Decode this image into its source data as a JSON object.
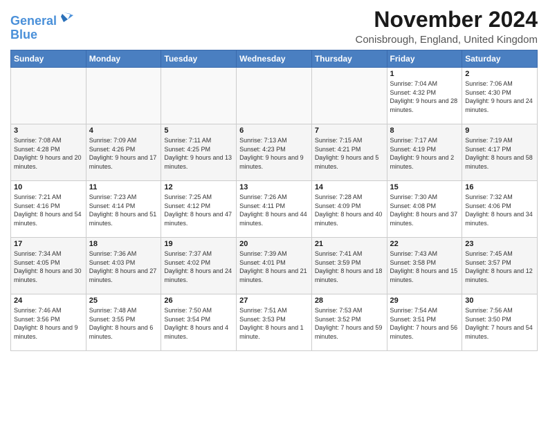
{
  "logo": {
    "line1": "General",
    "line2": "Blue"
  },
  "title": "November 2024",
  "subtitle": "Conisbrough, England, United Kingdom",
  "days_of_week": [
    "Sunday",
    "Monday",
    "Tuesday",
    "Wednesday",
    "Thursday",
    "Friday",
    "Saturday"
  ],
  "weeks": [
    [
      {
        "day": "",
        "info": ""
      },
      {
        "day": "",
        "info": ""
      },
      {
        "day": "",
        "info": ""
      },
      {
        "day": "",
        "info": ""
      },
      {
        "day": "",
        "info": ""
      },
      {
        "day": "1",
        "info": "Sunrise: 7:04 AM\nSunset: 4:32 PM\nDaylight: 9 hours\nand 28 minutes."
      },
      {
        "day": "2",
        "info": "Sunrise: 7:06 AM\nSunset: 4:30 PM\nDaylight: 9 hours\nand 24 minutes."
      }
    ],
    [
      {
        "day": "3",
        "info": "Sunrise: 7:08 AM\nSunset: 4:28 PM\nDaylight: 9 hours\nand 20 minutes."
      },
      {
        "day": "4",
        "info": "Sunrise: 7:09 AM\nSunset: 4:26 PM\nDaylight: 9 hours\nand 17 minutes."
      },
      {
        "day": "5",
        "info": "Sunrise: 7:11 AM\nSunset: 4:25 PM\nDaylight: 9 hours\nand 13 minutes."
      },
      {
        "day": "6",
        "info": "Sunrise: 7:13 AM\nSunset: 4:23 PM\nDaylight: 9 hours\nand 9 minutes."
      },
      {
        "day": "7",
        "info": "Sunrise: 7:15 AM\nSunset: 4:21 PM\nDaylight: 9 hours\nand 5 minutes."
      },
      {
        "day": "8",
        "info": "Sunrise: 7:17 AM\nSunset: 4:19 PM\nDaylight: 9 hours\nand 2 minutes."
      },
      {
        "day": "9",
        "info": "Sunrise: 7:19 AM\nSunset: 4:17 PM\nDaylight: 8 hours\nand 58 minutes."
      }
    ],
    [
      {
        "day": "10",
        "info": "Sunrise: 7:21 AM\nSunset: 4:16 PM\nDaylight: 8 hours\nand 54 minutes."
      },
      {
        "day": "11",
        "info": "Sunrise: 7:23 AM\nSunset: 4:14 PM\nDaylight: 8 hours\nand 51 minutes."
      },
      {
        "day": "12",
        "info": "Sunrise: 7:25 AM\nSunset: 4:12 PM\nDaylight: 8 hours\nand 47 minutes."
      },
      {
        "day": "13",
        "info": "Sunrise: 7:26 AM\nSunset: 4:11 PM\nDaylight: 8 hours\nand 44 minutes."
      },
      {
        "day": "14",
        "info": "Sunrise: 7:28 AM\nSunset: 4:09 PM\nDaylight: 8 hours\nand 40 minutes."
      },
      {
        "day": "15",
        "info": "Sunrise: 7:30 AM\nSunset: 4:08 PM\nDaylight: 8 hours\nand 37 minutes."
      },
      {
        "day": "16",
        "info": "Sunrise: 7:32 AM\nSunset: 4:06 PM\nDaylight: 8 hours\nand 34 minutes."
      }
    ],
    [
      {
        "day": "17",
        "info": "Sunrise: 7:34 AM\nSunset: 4:05 PM\nDaylight: 8 hours\nand 30 minutes."
      },
      {
        "day": "18",
        "info": "Sunrise: 7:36 AM\nSunset: 4:03 PM\nDaylight: 8 hours\nand 27 minutes."
      },
      {
        "day": "19",
        "info": "Sunrise: 7:37 AM\nSunset: 4:02 PM\nDaylight: 8 hours\nand 24 minutes."
      },
      {
        "day": "20",
        "info": "Sunrise: 7:39 AM\nSunset: 4:01 PM\nDaylight: 8 hours\nand 21 minutes."
      },
      {
        "day": "21",
        "info": "Sunrise: 7:41 AM\nSunset: 3:59 PM\nDaylight: 8 hours\nand 18 minutes."
      },
      {
        "day": "22",
        "info": "Sunrise: 7:43 AM\nSunset: 3:58 PM\nDaylight: 8 hours\nand 15 minutes."
      },
      {
        "day": "23",
        "info": "Sunrise: 7:45 AM\nSunset: 3:57 PM\nDaylight: 8 hours\nand 12 minutes."
      }
    ],
    [
      {
        "day": "24",
        "info": "Sunrise: 7:46 AM\nSunset: 3:56 PM\nDaylight: 8 hours\nand 9 minutes."
      },
      {
        "day": "25",
        "info": "Sunrise: 7:48 AM\nSunset: 3:55 PM\nDaylight: 8 hours\nand 6 minutes."
      },
      {
        "day": "26",
        "info": "Sunrise: 7:50 AM\nSunset: 3:54 PM\nDaylight: 8 hours\nand 4 minutes."
      },
      {
        "day": "27",
        "info": "Sunrise: 7:51 AM\nSunset: 3:53 PM\nDaylight: 8 hours\nand 1 minute."
      },
      {
        "day": "28",
        "info": "Sunrise: 7:53 AM\nSunset: 3:52 PM\nDaylight: 7 hours\nand 59 minutes."
      },
      {
        "day": "29",
        "info": "Sunrise: 7:54 AM\nSunset: 3:51 PM\nDaylight: 7 hours\nand 56 minutes."
      },
      {
        "day": "30",
        "info": "Sunrise: 7:56 AM\nSunset: 3:50 PM\nDaylight: 7 hours\nand 54 minutes."
      }
    ]
  ]
}
